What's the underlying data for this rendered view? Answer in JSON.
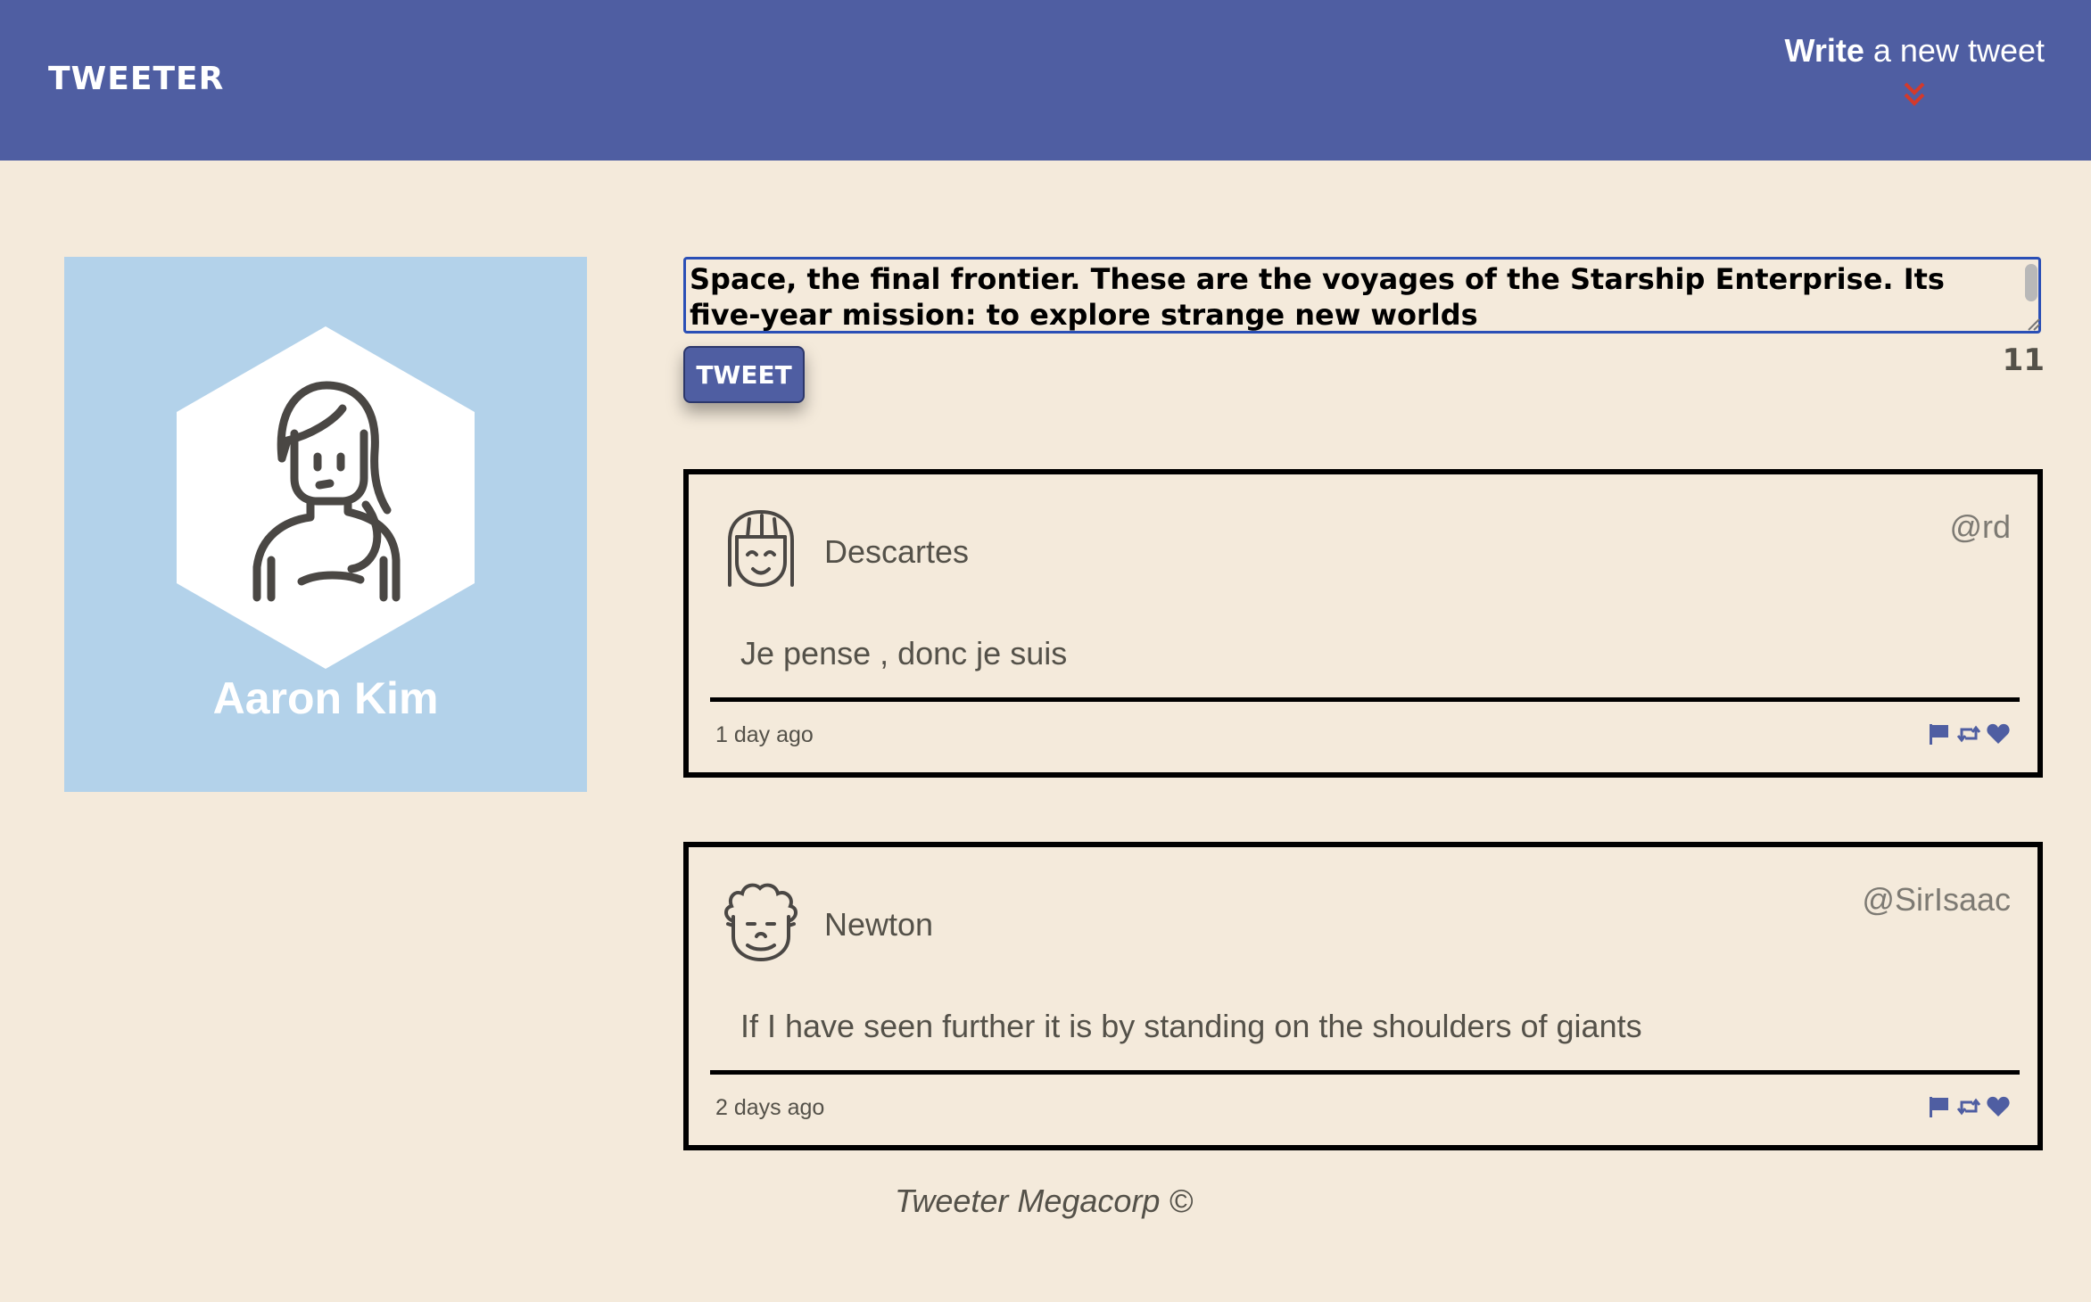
{
  "nav": {
    "brand": "TWEETER",
    "compose_bold": "Write",
    "compose_rest": " a new tweet",
    "accent_color": "#d33a2c",
    "bar_color": "#4f5ea2"
  },
  "profile": {
    "name": "Aaron Kim",
    "background_color": "#b3d2ea"
  },
  "composer": {
    "text": "Space, the final frontier. These are the voyages of the Starship Enterprise. Its five-year mission: to explore strange new worlds",
    "button_label": "TWEET",
    "char_count": "11"
  },
  "tweets": [
    {
      "name": "Descartes",
      "handle": "@rd",
      "content": "Je pense , donc je suis",
      "time": "1 day ago"
    },
    {
      "name": "Newton",
      "handle": "@SirIsaac",
      "content": "If I have seen further it is by standing on the shoulders of giants",
      "time": "2 days ago"
    }
  ],
  "footer": {
    "text": "Tweeter Megacorp ©"
  }
}
